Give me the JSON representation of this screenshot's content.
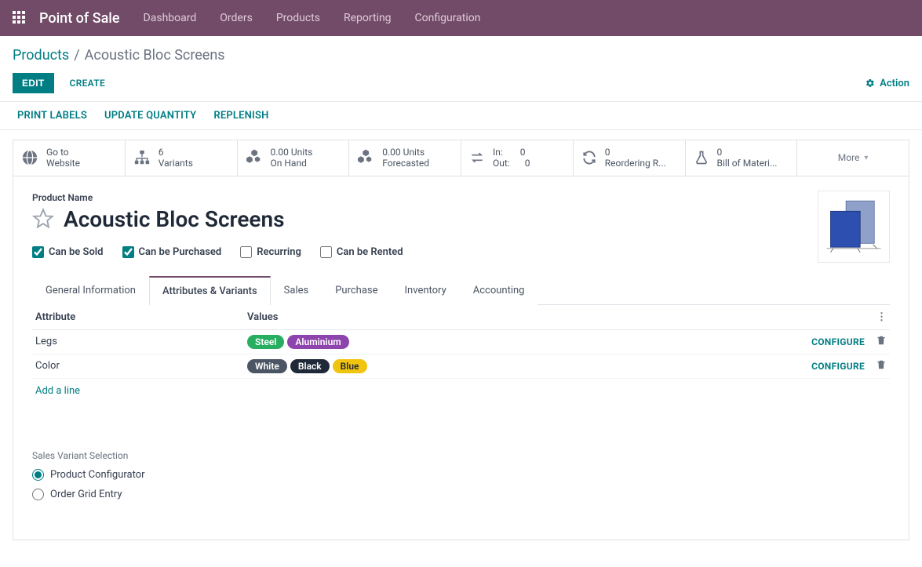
{
  "topbar": {
    "app_title": "Point of Sale",
    "menu": [
      "Dashboard",
      "Orders",
      "Products",
      "Reporting",
      "Configuration"
    ]
  },
  "breadcrumb": {
    "root": "Products",
    "sep": "/",
    "current": "Acoustic Bloc Screens"
  },
  "controls": {
    "edit": "EDIT",
    "create": "CREATE",
    "action": "Action"
  },
  "toolbar": [
    "PRINT LABELS",
    "UPDATE QUANTITY",
    "REPLENISH"
  ],
  "stats": {
    "website": {
      "l1": "Go to",
      "l2": "Website"
    },
    "variants": {
      "l1": "6",
      "l2": "Variants"
    },
    "onhand": {
      "l1": "0.00 Units",
      "l2": "On Hand"
    },
    "forecast": {
      "l1": "0.00 Units",
      "l2": "Forecasted"
    },
    "inout": {
      "in_label": "In:",
      "in_val": "0",
      "out_label": "Out:",
      "out_val": "0"
    },
    "reorder": {
      "l1": "0",
      "l2": "Reordering R..."
    },
    "bom": {
      "l1": "0",
      "l2": "Bill of Materi..."
    },
    "more": "More"
  },
  "form": {
    "name_label": "Product Name",
    "title": "Acoustic Bloc Screens",
    "checks": {
      "sold": "Can be Sold",
      "purchased": "Can be Purchased",
      "recurring": "Recurring",
      "rented": "Can be Rented"
    },
    "tabs": [
      "General Information",
      "Attributes & Variants",
      "Sales",
      "Purchase",
      "Inventory",
      "Accounting"
    ],
    "active_tab_index": 1,
    "attr_header": {
      "attribute": "Attribute",
      "values": "Values"
    },
    "rows": [
      {
        "name": "Legs",
        "values": [
          {
            "text": "Steel",
            "cls": "green"
          },
          {
            "text": "Aluminium",
            "cls": "purple"
          }
        ]
      },
      {
        "name": "Color",
        "values": [
          {
            "text": "White",
            "cls": "darkgray"
          },
          {
            "text": "Black",
            "cls": "black"
          },
          {
            "text": "Blue",
            "cls": "yellow"
          }
        ]
      }
    ],
    "configure": "CONFIGURE",
    "add_line": "Add a line",
    "variant_section_label": "Sales Variant Selection",
    "radio": {
      "configurator": "Product Configurator",
      "grid": "Order Grid Entry"
    }
  }
}
